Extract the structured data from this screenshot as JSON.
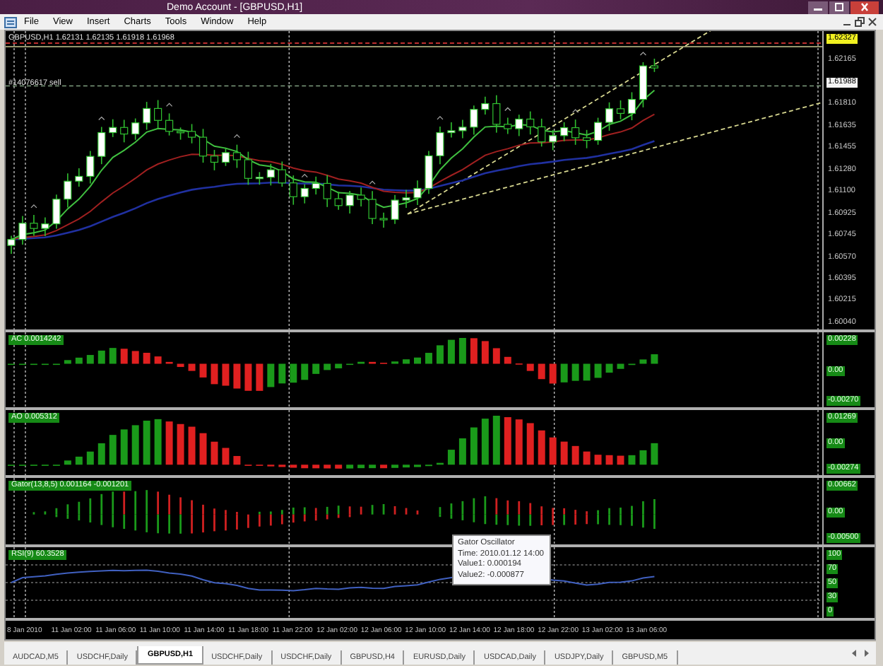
{
  "window": {
    "title": "Demo Account - [GBPUSD,H1]"
  },
  "menu": [
    "File",
    "View",
    "Insert",
    "Charts",
    "Tools",
    "Window",
    "Help"
  ],
  "chart": {
    "title": "GBPUSD,H1 1.62131 1.62135 1.61918 1.61968",
    "order_label": "#14076617 sell",
    "price_ticks": [
      {
        "label": "1.62327",
        "kind": "ask"
      },
      {
        "label": "1.62165",
        "kind": "plain"
      },
      {
        "label": "1.61988",
        "kind": "bid"
      },
      {
        "label": "1.61810",
        "kind": "plain"
      },
      {
        "label": "1.61635",
        "kind": "plain"
      },
      {
        "label": "1.61455",
        "kind": "plain"
      },
      {
        "label": "1.61280",
        "kind": "plain"
      },
      {
        "label": "1.61100",
        "kind": "plain"
      },
      {
        "label": "1.60925",
        "kind": "plain"
      },
      {
        "label": "1.60745",
        "kind": "plain"
      },
      {
        "label": "1.60570",
        "kind": "plain"
      },
      {
        "label": "1.60395",
        "kind": "plain"
      },
      {
        "label": "1.60215",
        "kind": "plain"
      },
      {
        "label": "1.60040",
        "kind": "plain"
      }
    ]
  },
  "indicators": [
    {
      "kind": "ac",
      "label": "AC 0.0014242",
      "ticks": [
        "0.00228",
        "0.00",
        "-0.00270"
      ]
    },
    {
      "kind": "ao",
      "label": "AO 0.005312",
      "ticks": [
        "0.01269",
        "0.00",
        "-0.00274"
      ]
    },
    {
      "kind": "gator",
      "label": "Gator(13,8,5) 0.001164 -0.001201",
      "ticks": [
        "0.00662",
        "0.00",
        "-0.00500"
      ]
    },
    {
      "kind": "rsi",
      "label": "RSI(9) 60.3528",
      "ticks": [
        "100",
        "70",
        "50",
        "30",
        "0"
      ]
    }
  ],
  "time_axis": [
    "8 Jan 2010",
    "11 Jan 02:00",
    "11 Jan 06:00",
    "11 Jan 10:00",
    "11 Jan 14:00",
    "11 Jan 18:00",
    "11 Jan 22:00",
    "12 Jan 02:00",
    "12 Jan 06:00",
    "12 Jan 10:00",
    "12 Jan 14:00",
    "12 Jan 18:00",
    "12 Jan 22:00",
    "13 Jan 02:00",
    "13 Jan 06:00"
  ],
  "tooltip": {
    "title": "Gator Oscillator",
    "lines": [
      "Time: 2010.01.12 14:00",
      "Value1: 0.000194",
      "Value2: -0.000877"
    ]
  },
  "tabs": [
    {
      "label": "AUDCAD,M5",
      "selected": false
    },
    {
      "label": "USDCHF,Daily",
      "selected": false
    },
    {
      "label": "GBPUSD,H1",
      "selected": true
    },
    {
      "label": "USDCHF,Daily",
      "selected": false
    },
    {
      "label": "USDCHF,Daily",
      "selected": false
    },
    {
      "label": "GBPUSD,H4",
      "selected": false
    },
    {
      "label": "EURUSD,Daily",
      "selected": false
    },
    {
      "label": "USDCAD,Daily",
      "selected": false
    },
    {
      "label": "USDJPY,Daily",
      "selected": false
    },
    {
      "label": "GBPUSD,M5",
      "selected": false
    }
  ]
}
